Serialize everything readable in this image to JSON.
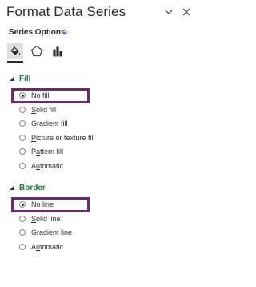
{
  "pane": {
    "title": "Format Data Series",
    "series_options_label": "Series Options",
    "tabs": [
      {
        "name": "fill-line",
        "icon": "paint-bucket-icon",
        "active": true
      },
      {
        "name": "effects",
        "icon": "pentagon-icon",
        "active": false
      },
      {
        "name": "series-options",
        "icon": "bar-chart-icon",
        "active": false
      }
    ]
  },
  "fill": {
    "header": "Fill",
    "options": [
      {
        "pre": "",
        "key": "N",
        "post": "o fill",
        "checked": true
      },
      {
        "pre": "",
        "key": "S",
        "post": "olid fill",
        "checked": false
      },
      {
        "pre": "",
        "key": "G",
        "post": "radient fill",
        "checked": false
      },
      {
        "pre": "",
        "key": "P",
        "post": "icture or texture fill",
        "checked": false
      },
      {
        "pre": "P",
        "key": "a",
        "post": "ttern fill",
        "checked": false
      },
      {
        "pre": "A",
        "key": "u",
        "post": "tomatic",
        "checked": false
      }
    ]
  },
  "border": {
    "header": "Border",
    "options": [
      {
        "pre": "",
        "key": "N",
        "post": "o line",
        "checked": true
      },
      {
        "pre": "",
        "key": "S",
        "post": "olid line",
        "checked": false
      },
      {
        "pre": "",
        "key": "G",
        "post": "radient line",
        "checked": false
      },
      {
        "pre": "A",
        "key": "u",
        "post": "tomatic",
        "checked": false
      }
    ]
  },
  "colors": {
    "section_header": "#217346",
    "highlight_box": "#6b2c6f",
    "series_chevron": "#2b79c5"
  }
}
